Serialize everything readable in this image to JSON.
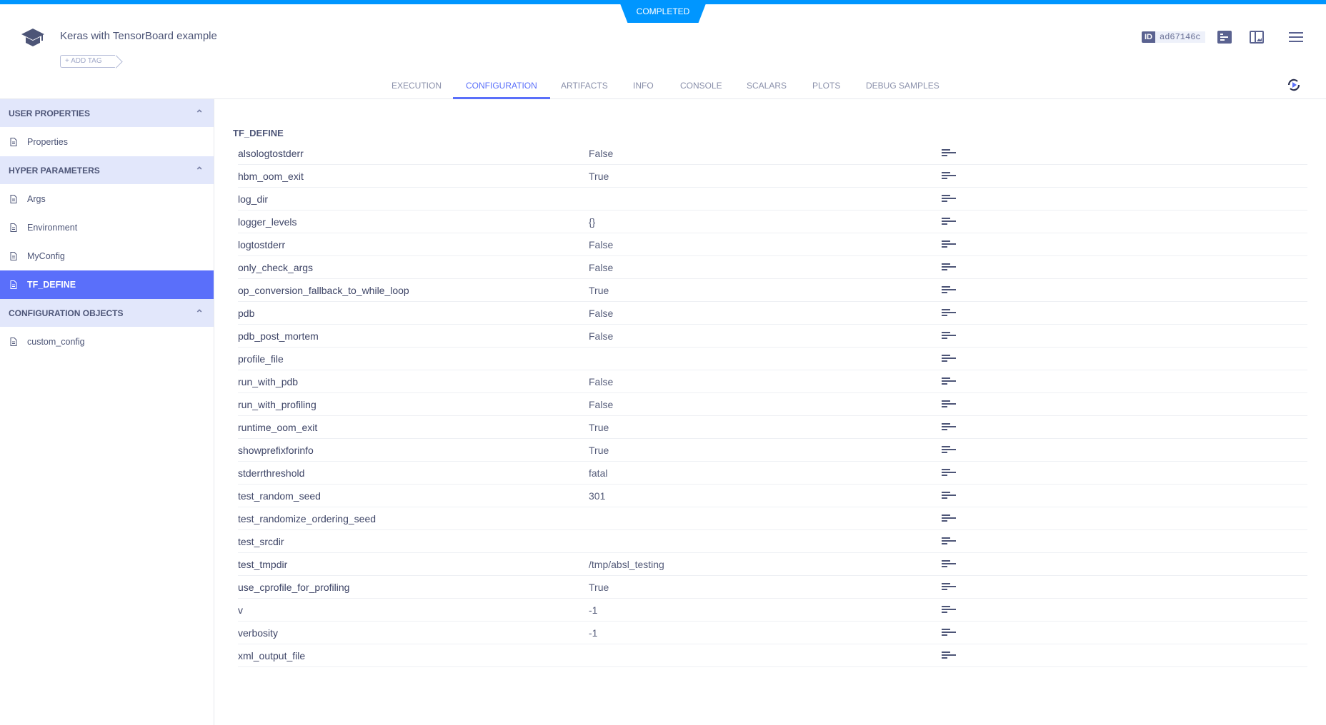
{
  "header": {
    "status": "COMPLETED",
    "title": "Keras with TensorBoard example",
    "add_tag": "+ ADD TAG",
    "id_label": "ID",
    "id_value": "ad67146c"
  },
  "tabs": [
    {
      "label": "EXECUTION"
    },
    {
      "label": "CONFIGURATION",
      "active": true
    },
    {
      "label": "ARTIFACTS"
    },
    {
      "label": "INFO"
    },
    {
      "label": "CONSOLE"
    },
    {
      "label": "SCALARS"
    },
    {
      "label": "PLOTS"
    },
    {
      "label": "DEBUG SAMPLES"
    }
  ],
  "sidebar": {
    "sections": [
      {
        "title": "USER PROPERTIES",
        "items": [
          "Properties"
        ]
      },
      {
        "title": "HYPER PARAMETERS",
        "items": [
          "Args",
          "Environment",
          "MyConfig",
          "TF_DEFINE"
        ]
      },
      {
        "title": "CONFIGURATION OBJECTS",
        "items": [
          "custom_config"
        ]
      }
    ],
    "selected": "TF_DEFINE"
  },
  "main": {
    "section_title": "TF_DEFINE",
    "rows": [
      {
        "name": "alsologtostderr",
        "value": "False"
      },
      {
        "name": "hbm_oom_exit",
        "value": "True"
      },
      {
        "name": "log_dir",
        "value": ""
      },
      {
        "name": "logger_levels",
        "value": "{}"
      },
      {
        "name": "logtostderr",
        "value": "False"
      },
      {
        "name": "only_check_args",
        "value": "False"
      },
      {
        "name": "op_conversion_fallback_to_while_loop",
        "value": "True"
      },
      {
        "name": "pdb",
        "value": "False"
      },
      {
        "name": "pdb_post_mortem",
        "value": "False"
      },
      {
        "name": "profile_file",
        "value": ""
      },
      {
        "name": "run_with_pdb",
        "value": "False"
      },
      {
        "name": "run_with_profiling",
        "value": "False"
      },
      {
        "name": "runtime_oom_exit",
        "value": "True"
      },
      {
        "name": "showprefixforinfo",
        "value": "True"
      },
      {
        "name": "stderrthreshold",
        "value": "fatal"
      },
      {
        "name": "test_random_seed",
        "value": "301"
      },
      {
        "name": "test_randomize_ordering_seed",
        "value": ""
      },
      {
        "name": "test_srcdir",
        "value": ""
      },
      {
        "name": "test_tmpdir",
        "value": "/tmp/absl_testing"
      },
      {
        "name": "use_cprofile_for_profiling",
        "value": "True"
      },
      {
        "name": "v",
        "value": "-1"
      },
      {
        "name": "verbosity",
        "value": "-1"
      },
      {
        "name": "xml_output_file",
        "value": ""
      }
    ]
  },
  "colors": {
    "accent": "#5a6ffa",
    "status": "#0096ff",
    "sidebar_header": "#e2e7fb"
  }
}
